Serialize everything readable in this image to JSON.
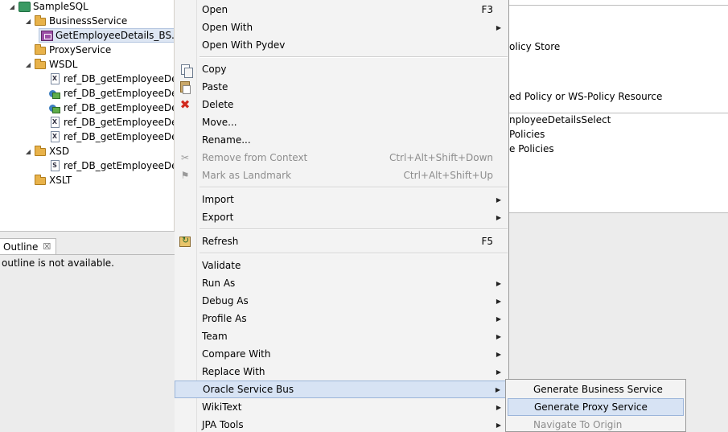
{
  "tree": {
    "items": [
      {
        "label": "SampleSQL",
        "twisty": "expanded",
        "icon": "project-icon"
      },
      {
        "label": "BusinessService",
        "twisty": "expanded",
        "icon": "folder-icon"
      },
      {
        "label": "GetEmployeeDetails_BS.b",
        "twisty": "none",
        "icon": "business-service-icon",
        "selected": true
      },
      {
        "label": "ProxyService",
        "twisty": "none",
        "icon": "folder-icon"
      },
      {
        "label": "WSDL",
        "twisty": "expanded",
        "icon": "folder-icon"
      },
      {
        "label": "ref_DB_getEmployeeDeta",
        "twisty": "none",
        "icon": "xml-file-icon",
        "glyph": "X"
      },
      {
        "label": "ref_DB_getEmployeeDeta",
        "twisty": "none",
        "icon": "wsdl-icon"
      },
      {
        "label": "ref_DB_getEmployeeDeta",
        "twisty": "none",
        "icon": "wsdl-icon"
      },
      {
        "label": "ref_DB_getEmployeeDeta",
        "twisty": "none",
        "icon": "xml-file-icon",
        "glyph": "X"
      },
      {
        "label": "ref_DB_getEmployeeDeta",
        "twisty": "none",
        "icon": "xml-file-icon",
        "glyph": "X"
      },
      {
        "label": "XSD",
        "twisty": "expanded",
        "icon": "folder-icon"
      },
      {
        "label": "ref_DB_getEmployeeDeta",
        "twisty": "none",
        "icon": "schema-file-icon",
        "glyph": "S"
      },
      {
        "label": "XSLT",
        "twisty": "none",
        "icon": "folder-icon"
      }
    ]
  },
  "outline": {
    "tab_label": "Outline",
    "close_glyph": "☒",
    "message": "outline is not available."
  },
  "editor": {
    "fragments": [
      "olicy Store",
      "ed Policy or WS-Policy Resource",
      "nployeeDetailsSelect",
      "Policies",
      "e Policies"
    ]
  },
  "context_menu": {
    "items": [
      {
        "label": "Open",
        "shortcut": "F3"
      },
      {
        "label": "Open With",
        "submenu": true
      },
      {
        "label": "Open With Pydev"
      },
      {
        "sep": true
      },
      {
        "label": "Copy",
        "icon": "copy-icon"
      },
      {
        "label": "Paste",
        "icon": "paste-icon"
      },
      {
        "label": "Delete",
        "icon": "delete-icon"
      },
      {
        "label": "Move..."
      },
      {
        "label": "Rename..."
      },
      {
        "label": "Remove from Context",
        "shortcut": "Ctrl+Alt+Shift+Down",
        "disabled": true,
        "icon": "remove-context-icon"
      },
      {
        "label": "Mark as Landmark",
        "shortcut": "Ctrl+Alt+Shift+Up",
        "disabled": true,
        "icon": "landmark-icon"
      },
      {
        "sep": true
      },
      {
        "label": "Import",
        "submenu": true
      },
      {
        "label": "Export",
        "submenu": true
      },
      {
        "sep": true
      },
      {
        "label": "Refresh",
        "shortcut": "F5",
        "icon": "refresh-icon"
      },
      {
        "sep": true
      },
      {
        "label": "Validate"
      },
      {
        "label": "Run As",
        "submenu": true
      },
      {
        "label": "Debug As",
        "submenu": true
      },
      {
        "label": "Profile As",
        "submenu": true
      },
      {
        "label": "Team",
        "submenu": true
      },
      {
        "label": "Compare With",
        "submenu": true
      },
      {
        "label": "Replace With",
        "submenu": true
      },
      {
        "label": "Oracle Service Bus",
        "submenu": true,
        "highlight": true
      },
      {
        "label": "WikiText",
        "submenu": true
      },
      {
        "label": "JPA Tools",
        "submenu": true
      }
    ]
  },
  "submenu": {
    "items": [
      {
        "label": "Generate Business Service"
      },
      {
        "label": "Generate Proxy Service",
        "highlight": true
      },
      {
        "label": "Navigate To Origin",
        "disabled": true
      }
    ]
  }
}
